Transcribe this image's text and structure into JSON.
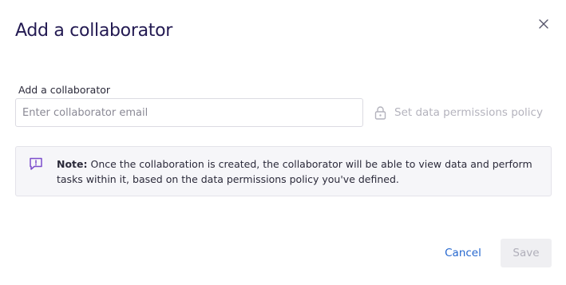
{
  "dialog": {
    "title": "Add a collaborator",
    "close_icon": "close-icon"
  },
  "form": {
    "email_label": "Add a collaborator",
    "email_value": "",
    "email_placeholder": "Enter collaborator email",
    "permissions_label": "Set data permissions policy",
    "permissions_icon": "lock-icon",
    "permissions_disabled": true
  },
  "note": {
    "icon": "message-alert-icon",
    "prefix": "Note:",
    "text": "Once the collaboration is created, the collaborator will be able to view data and perform tasks within it, based on the data permissions policy you've defined."
  },
  "footer": {
    "cancel_label": "Cancel",
    "save_label": "Save",
    "save_disabled": true
  },
  "colors": {
    "title": "#231a52",
    "link": "#2567cf",
    "disabled_text": "#b4b3bd",
    "note_icon": "#7c4dcc",
    "note_bg": "#f6f6f9"
  }
}
